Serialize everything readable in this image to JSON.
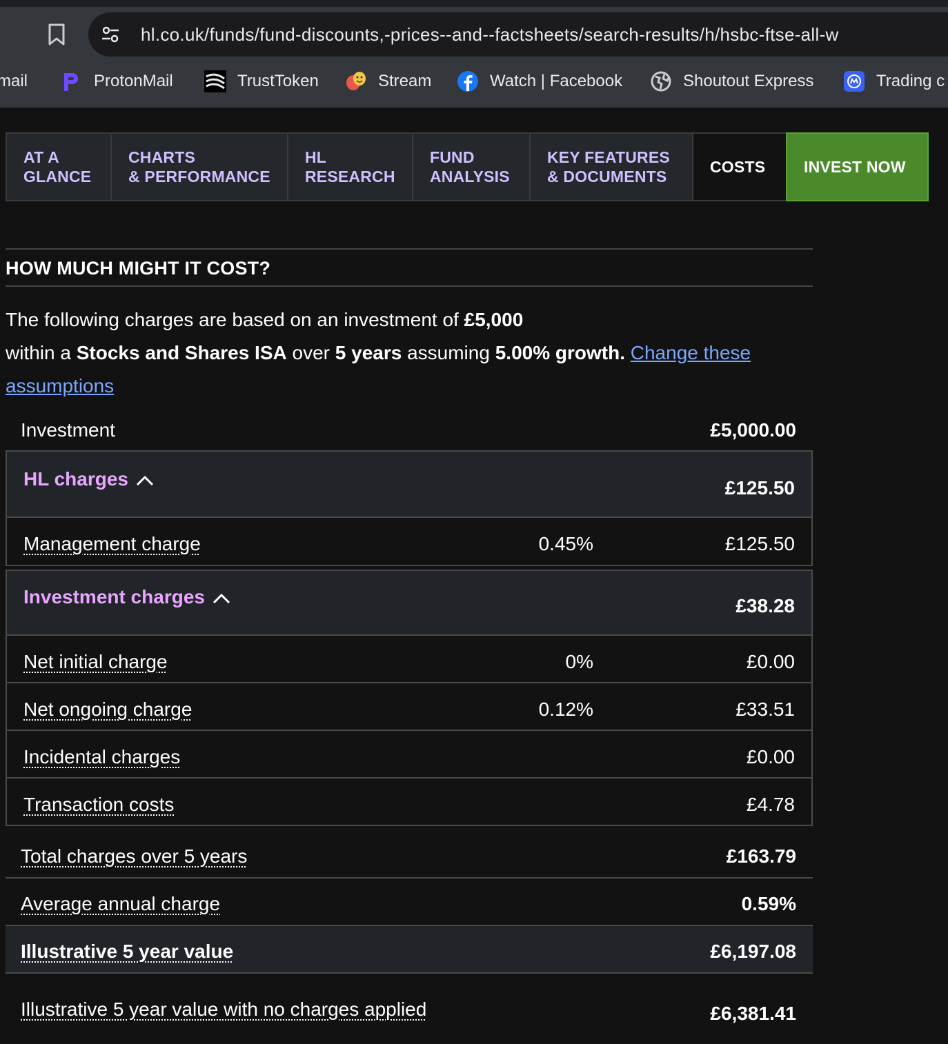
{
  "browser": {
    "url": "hl.co.uk/funds/fund-discounts,-prices--and--factsheets/search-results/h/hsbc-ftse-all-w",
    "bookmarks": [
      {
        "label": "mail",
        "icon": "none"
      },
      {
        "label": "ProtonMail",
        "icon": "protonmail-icon"
      },
      {
        "label": "TrustToken",
        "icon": "trusttoken-icon"
      },
      {
        "label": "Stream",
        "icon": "theatre-masks-icon"
      },
      {
        "label": "Watch | Facebook",
        "icon": "facebook-icon"
      },
      {
        "label": "Shoutout Express",
        "icon": "globe-icon"
      },
      {
        "label": "Trading c",
        "icon": "trading-icon"
      }
    ]
  },
  "tabs": [
    {
      "line1": "AT A",
      "line2": "GLANCE"
    },
    {
      "line1": "CHARTS",
      "line2": "& PERFORMANCE"
    },
    {
      "line1": "HL",
      "line2": "RESEARCH"
    },
    {
      "line1": "FUND",
      "line2": "ANALYSIS"
    },
    {
      "line1": "KEY FEATURES",
      "line2": "& DOCUMENTS"
    },
    {
      "line1": "COSTS",
      "line2": ""
    },
    {
      "line1": "INVEST NOW",
      "line2": ""
    }
  ],
  "costs": {
    "title": "HOW MUCH MIGHT IT COST?",
    "intro": {
      "p1": "The following charges are based on an investment of ",
      "amount": "£5,000",
      "p2": "within a ",
      "account": "Stocks and Shares ISA",
      "p3": " over ",
      "years": "5 years",
      "p4": " assuming ",
      "growth": "5.00% growth.",
      "link": "Change these assumptions"
    },
    "investment": {
      "label": "Investment",
      "amount": "£5,000.00"
    },
    "hl_charges": {
      "label": "HL charges",
      "total": "£125.50",
      "rows": [
        {
          "label": "Management charge",
          "pct": "0.45%",
          "amount": "£125.50"
        }
      ]
    },
    "investment_charges": {
      "label": "Investment charges",
      "total": "£38.28",
      "rows": [
        {
          "label": "Net initial charge",
          "pct": "0%",
          "amount": "£0.00"
        },
        {
          "label": "Net ongoing charge",
          "pct": "0.12%",
          "amount": "£33.51"
        },
        {
          "label": "Incidental charges",
          "pct": "",
          "amount": "£0.00"
        },
        {
          "label": "Transaction costs",
          "pct": "",
          "amount": "£4.78"
        }
      ]
    },
    "total": {
      "label": "Total charges over 5 years",
      "amount": "£163.79"
    },
    "average": {
      "label": "Average annual charge",
      "amount": "0.59%"
    },
    "illustrative": {
      "label": "Illustrative 5 year value",
      "amount": "£6,197.08"
    },
    "no_charges": {
      "label": "Illustrative 5 year value with no charges applied",
      "amount": "£6,381.41"
    }
  }
}
